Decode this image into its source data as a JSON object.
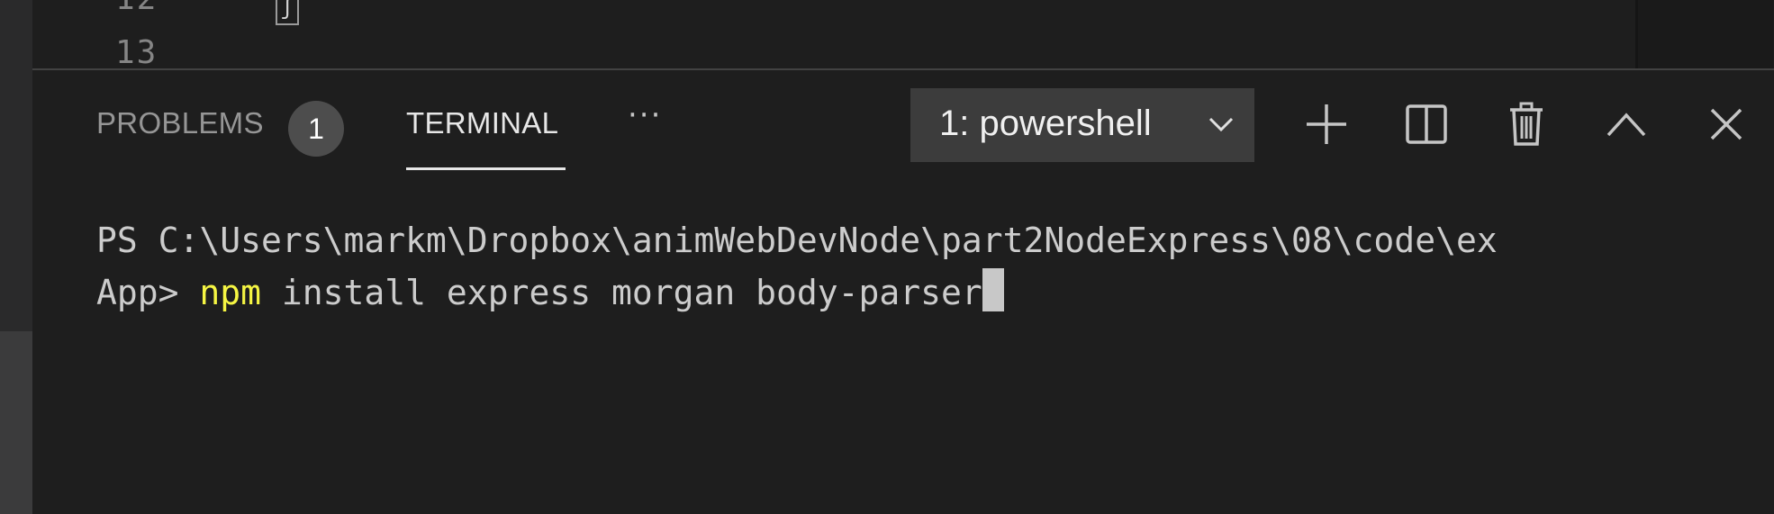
{
  "editor": {
    "line_numbers": [
      "12",
      "13"
    ],
    "line_12_glyph": "ʃ"
  },
  "panel": {
    "tabs": {
      "problems_label": "PROBLEMS",
      "problems_count": "1",
      "terminal_label": "TERMINAL",
      "more_label": "···"
    },
    "terminal_selector": {
      "selected": "1: powershell"
    },
    "actions": [
      "add-terminal",
      "split-terminal",
      "kill-terminal",
      "maximize-panel",
      "close-panel"
    ]
  },
  "terminal": {
    "line1": "PS C:\\Users\\markm\\Dropbox\\animWebDevNode\\part2NodeExpress\\08\\code\\ex",
    "prompt_continuation": "App> ",
    "command": "npm",
    "args": " install express morgan body-parser"
  },
  "colors": {
    "background": "#1e1e1e",
    "command_highlight": "#f5f543",
    "text": "#cccccc",
    "badge": "#4d4d4d"
  }
}
